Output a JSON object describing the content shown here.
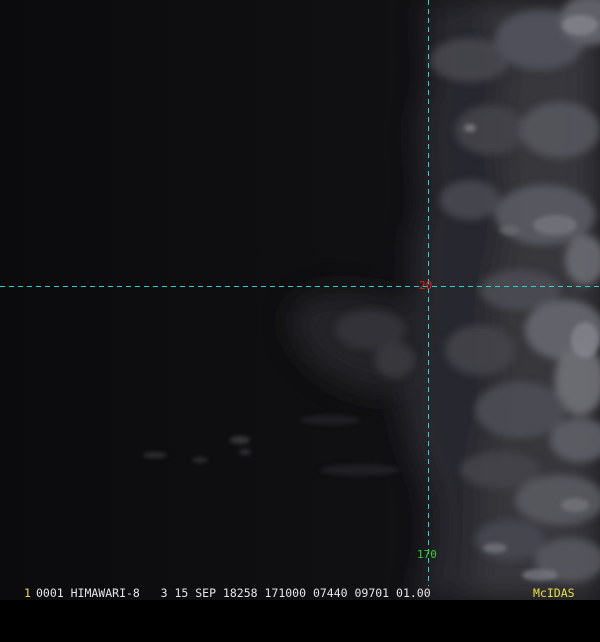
{
  "colors": {
    "background": "#0c0c0e",
    "grid_line": "#2fd0d0",
    "lat_label": "#e02020",
    "lon_label": "#30d030",
    "frame_number": "#e8e040",
    "header_text": "#e6e6e6",
    "branding": "#e8e040"
  },
  "imagery": {
    "description_type": "satellite-visible-band",
    "grid": {
      "latitude_label": "20",
      "longitude_label": "170"
    }
  },
  "footer": {
    "frame_number": "1",
    "header_text": "0001 HIMAWARI-8   3 15 SEP 18258 171000 07440 09701 01.00",
    "branding": "McIDAS"
  }
}
